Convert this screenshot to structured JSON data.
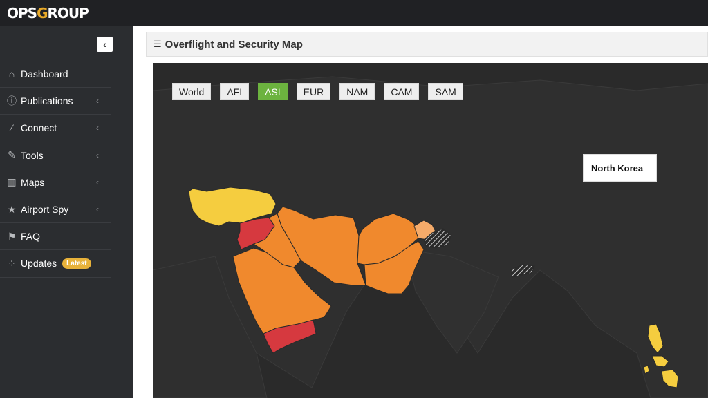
{
  "header": {
    "logo_text_a": "OPS",
    "logo_text_b": "G",
    "logo_text_c": "ROUP"
  },
  "sidebar": {
    "collapse_glyph": "‹",
    "items": [
      {
        "label": "Dashboard",
        "icon": "home-icon",
        "has_arrow": false
      },
      {
        "label": "Publications",
        "icon": "info-icon",
        "has_arrow": true
      },
      {
        "label": "Connect",
        "icon": "magic-wand-icon",
        "has_arrow": true
      },
      {
        "label": "Tools",
        "icon": "wrench-icon",
        "has_arrow": true
      },
      {
        "label": "Maps",
        "icon": "map-icon",
        "has_arrow": true
      },
      {
        "label": "Airport Spy",
        "icon": "star-icon",
        "has_arrow": true
      },
      {
        "label": "FAQ",
        "icon": "flag-icon",
        "has_arrow": false
      },
      {
        "label": "Updates",
        "icon": "spinner-icon",
        "has_arrow": false,
        "badge": "Latest"
      }
    ]
  },
  "main": {
    "title": "Overflight and Security Map",
    "region_tabs": [
      "World",
      "AFI",
      "ASI",
      "EUR",
      "NAM",
      "CAM",
      "SAM"
    ],
    "active_tab": "ASI",
    "tooltip": "North Korea"
  },
  "colors": {
    "active_tab": "#6cb33f",
    "risk_high": "#d6393f",
    "risk_medium": "#f0892d",
    "risk_low": "#f5cd3f",
    "map_background": "#2a2a2a",
    "land": "#2f2f2f"
  }
}
